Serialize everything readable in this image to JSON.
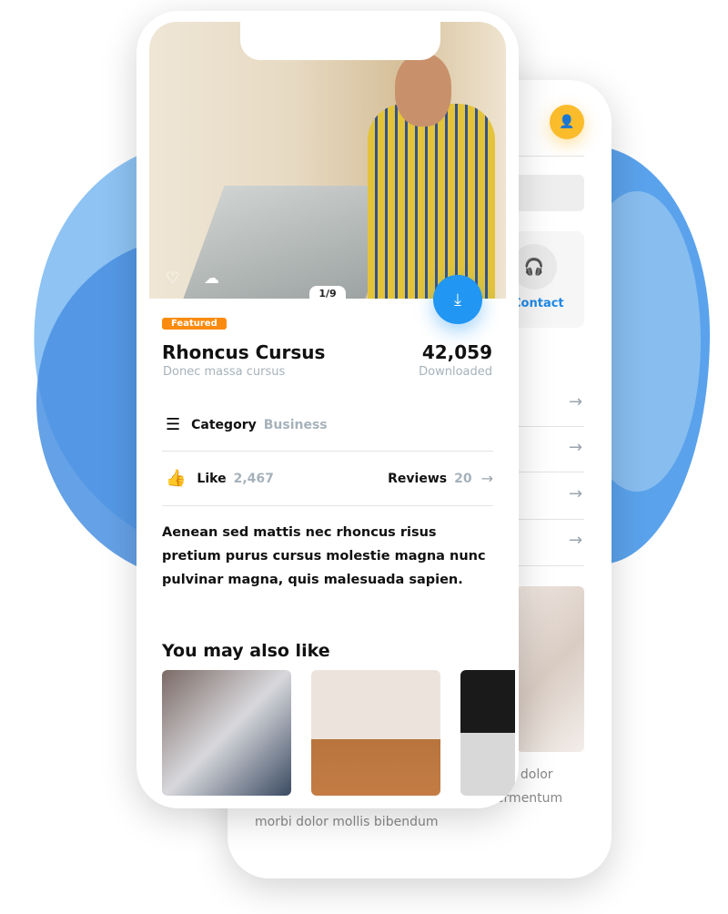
{
  "back_screen": {
    "contact_label": "Contact",
    "text_lines": [
      "t eu dolor",
      "fermentum",
      "morbi dolor mollis bibendum"
    ]
  },
  "front_screen": {
    "pager": "1/9",
    "badge": "Featured",
    "title": "Rhoncus Cursus",
    "subtitle": "Donec massa cursus",
    "downloads": "42,059",
    "downloads_label": "Downloaded",
    "category_label": "Category",
    "category_value": "Business",
    "like_label": "Like",
    "like_count": "2,467",
    "reviews_label": "Reviews",
    "reviews_count": "20",
    "description": "Aenean sed mattis nec rhoncus risus pretium purus cursus molestie magna nunc pulvinar magna, quis malesuada sapien.",
    "related_title": "You may also like"
  },
  "colors": {
    "accent": "#2196f3",
    "badge": "#f98b0f",
    "avatar": "#fbbc2c"
  }
}
